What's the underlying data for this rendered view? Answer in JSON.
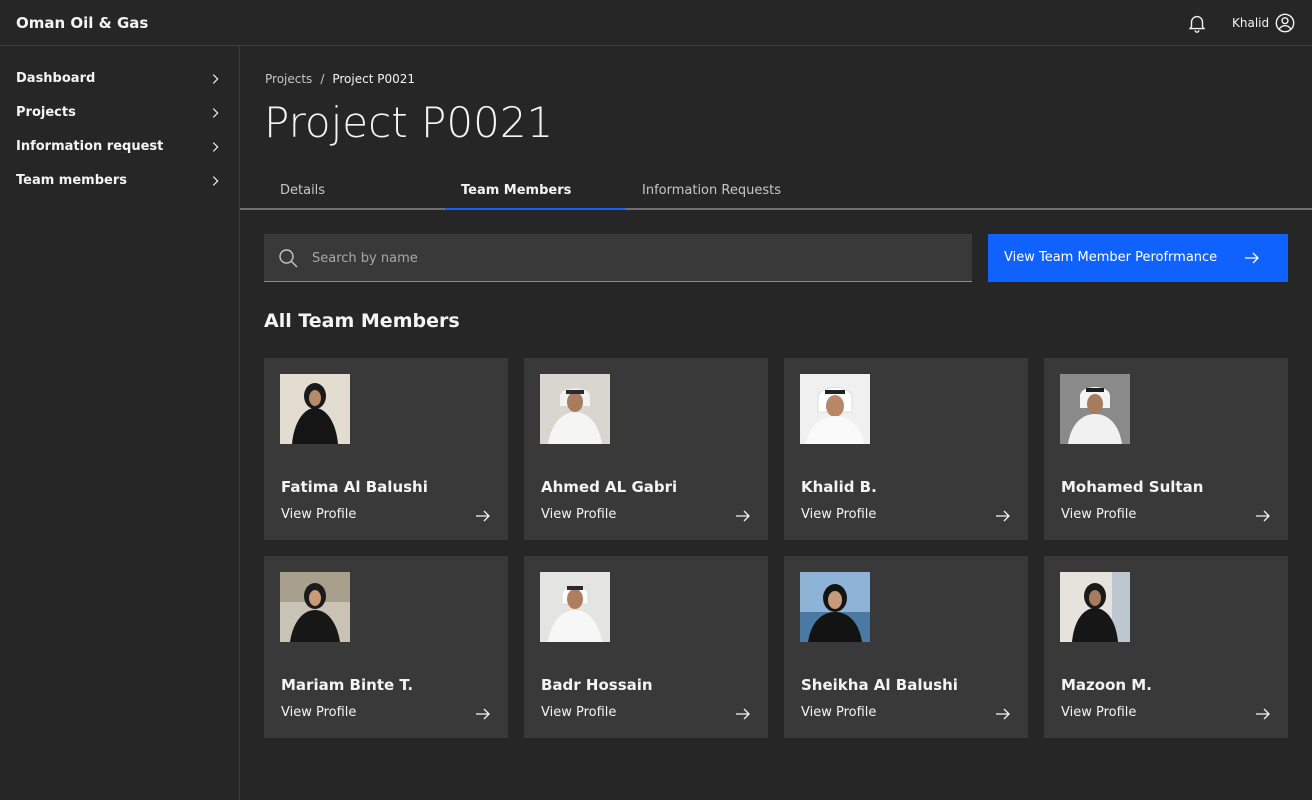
{
  "app": {
    "title": "Oman Oil & Gas",
    "user": "Khalid"
  },
  "sidebar": {
    "items": [
      {
        "label": "Dashboard"
      },
      {
        "label": "Projects"
      },
      {
        "label": "Information request"
      },
      {
        "label": "Team members"
      }
    ]
  },
  "breadcrumb": {
    "root": "Projects",
    "separator": "/",
    "current": "Project P0021"
  },
  "page": {
    "title": "Project P0021"
  },
  "tabs": [
    {
      "label": "Details",
      "active": false
    },
    {
      "label": "Team Members",
      "active": true
    },
    {
      "label": "Information Requests",
      "active": false
    }
  ],
  "search": {
    "placeholder": "Search by name",
    "value": ""
  },
  "actions": {
    "performance_button": "View Team Member Perofrmance"
  },
  "section": {
    "title": "All Team Members"
  },
  "members": [
    {
      "name": "Fatima Al Balushi",
      "link": "View Profile"
    },
    {
      "name": "Ahmed AL Gabri",
      "link": "View Profile"
    },
    {
      "name": "Khalid B.",
      "link": "View Profile"
    },
    {
      "name": "Mohamed Sultan",
      "link": "View Profile"
    },
    {
      "name": "Mariam Binte T.",
      "link": "View Profile"
    },
    {
      "name": "Badr Hossain",
      "link": "View Profile"
    },
    {
      "name": "Sheikha Al Balushi",
      "link": "View Profile"
    },
    {
      "name": "Mazoon M.",
      "link": "View Profile"
    }
  ],
  "colors": {
    "background": "#262626",
    "card": "#393939",
    "accent": "#0f62fe",
    "text": "#f4f4f4"
  }
}
